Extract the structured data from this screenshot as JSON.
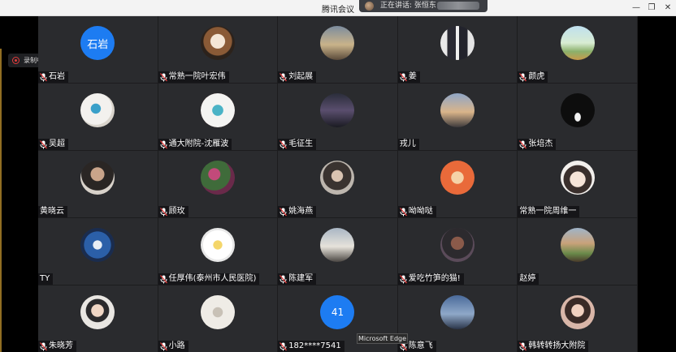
{
  "window": {
    "title": "腾讯会议"
  },
  "speaking": {
    "label": "正在讲话: 张恒东"
  },
  "recording": {
    "label": "录制中"
  },
  "tooltip": {
    "text": "Microsoft Edge"
  },
  "participants": [
    {
      "name": "石岩",
      "avatar_text": "石岩",
      "mic": true
    },
    {
      "name": "常熟一院叶宏伟",
      "mic": true
    },
    {
      "name": "刘起展",
      "mic": true
    },
    {
      "name": "姜",
      "mic": true
    },
    {
      "name": "颜虎",
      "mic": true
    },
    {
      "name": "吴超",
      "mic": true
    },
    {
      "name": "通大附院-沈雁波",
      "mic": true
    },
    {
      "name": "毛征生",
      "mic": true
    },
    {
      "name": "戎儿",
      "mic": false
    },
    {
      "name": "张培杰",
      "mic": true
    },
    {
      "name": "黄晓云",
      "mic": false
    },
    {
      "name": "顾玫",
      "mic": true
    },
    {
      "name": "姚海燕",
      "mic": true
    },
    {
      "name": "呦呦哒",
      "mic": true
    },
    {
      "name": "常熟一院周维一",
      "mic": false
    },
    {
      "name": "TY",
      "mic": false
    },
    {
      "name": "任厚伟(泰州市人民医院)",
      "mic": true
    },
    {
      "name": "陈建军",
      "mic": true
    },
    {
      "name": "爱吃竹笋的猫!",
      "mic": true
    },
    {
      "name": "赵婷",
      "mic": false
    },
    {
      "name": "朱晓芳",
      "mic": true
    },
    {
      "name": "小路",
      "mic": true
    },
    {
      "name": "182****7541",
      "avatar_text": "41",
      "mic": true
    },
    {
      "name": "陈意飞",
      "mic": true
    },
    {
      "name": "韩转转扬大附院",
      "mic": true
    }
  ]
}
